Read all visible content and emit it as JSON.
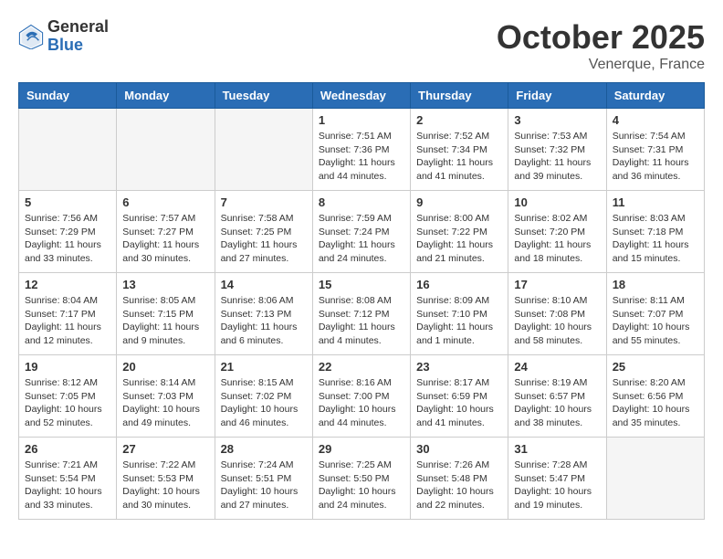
{
  "header": {
    "logo_general": "General",
    "logo_blue": "Blue",
    "month": "October 2025",
    "location": "Venerque, France"
  },
  "days_of_week": [
    "Sunday",
    "Monday",
    "Tuesday",
    "Wednesday",
    "Thursday",
    "Friday",
    "Saturday"
  ],
  "weeks": [
    [
      {
        "day": "",
        "info": ""
      },
      {
        "day": "",
        "info": ""
      },
      {
        "day": "",
        "info": ""
      },
      {
        "day": "1",
        "info": "Sunrise: 7:51 AM\nSunset: 7:36 PM\nDaylight: 11 hours and 44 minutes."
      },
      {
        "day": "2",
        "info": "Sunrise: 7:52 AM\nSunset: 7:34 PM\nDaylight: 11 hours and 41 minutes."
      },
      {
        "day": "3",
        "info": "Sunrise: 7:53 AM\nSunset: 7:32 PM\nDaylight: 11 hours and 39 minutes."
      },
      {
        "day": "4",
        "info": "Sunrise: 7:54 AM\nSunset: 7:31 PM\nDaylight: 11 hours and 36 minutes."
      }
    ],
    [
      {
        "day": "5",
        "info": "Sunrise: 7:56 AM\nSunset: 7:29 PM\nDaylight: 11 hours and 33 minutes."
      },
      {
        "day": "6",
        "info": "Sunrise: 7:57 AM\nSunset: 7:27 PM\nDaylight: 11 hours and 30 minutes."
      },
      {
        "day": "7",
        "info": "Sunrise: 7:58 AM\nSunset: 7:25 PM\nDaylight: 11 hours and 27 minutes."
      },
      {
        "day": "8",
        "info": "Sunrise: 7:59 AM\nSunset: 7:24 PM\nDaylight: 11 hours and 24 minutes."
      },
      {
        "day": "9",
        "info": "Sunrise: 8:00 AM\nSunset: 7:22 PM\nDaylight: 11 hours and 21 minutes."
      },
      {
        "day": "10",
        "info": "Sunrise: 8:02 AM\nSunset: 7:20 PM\nDaylight: 11 hours and 18 minutes."
      },
      {
        "day": "11",
        "info": "Sunrise: 8:03 AM\nSunset: 7:18 PM\nDaylight: 11 hours and 15 minutes."
      }
    ],
    [
      {
        "day": "12",
        "info": "Sunrise: 8:04 AM\nSunset: 7:17 PM\nDaylight: 11 hours and 12 minutes."
      },
      {
        "day": "13",
        "info": "Sunrise: 8:05 AM\nSunset: 7:15 PM\nDaylight: 11 hours and 9 minutes."
      },
      {
        "day": "14",
        "info": "Sunrise: 8:06 AM\nSunset: 7:13 PM\nDaylight: 11 hours and 6 minutes."
      },
      {
        "day": "15",
        "info": "Sunrise: 8:08 AM\nSunset: 7:12 PM\nDaylight: 11 hours and 4 minutes."
      },
      {
        "day": "16",
        "info": "Sunrise: 8:09 AM\nSunset: 7:10 PM\nDaylight: 11 hours and 1 minute."
      },
      {
        "day": "17",
        "info": "Sunrise: 8:10 AM\nSunset: 7:08 PM\nDaylight: 10 hours and 58 minutes."
      },
      {
        "day": "18",
        "info": "Sunrise: 8:11 AM\nSunset: 7:07 PM\nDaylight: 10 hours and 55 minutes."
      }
    ],
    [
      {
        "day": "19",
        "info": "Sunrise: 8:12 AM\nSunset: 7:05 PM\nDaylight: 10 hours and 52 minutes."
      },
      {
        "day": "20",
        "info": "Sunrise: 8:14 AM\nSunset: 7:03 PM\nDaylight: 10 hours and 49 minutes."
      },
      {
        "day": "21",
        "info": "Sunrise: 8:15 AM\nSunset: 7:02 PM\nDaylight: 10 hours and 46 minutes."
      },
      {
        "day": "22",
        "info": "Sunrise: 8:16 AM\nSunset: 7:00 PM\nDaylight: 10 hours and 44 minutes."
      },
      {
        "day": "23",
        "info": "Sunrise: 8:17 AM\nSunset: 6:59 PM\nDaylight: 10 hours and 41 minutes."
      },
      {
        "day": "24",
        "info": "Sunrise: 8:19 AM\nSunset: 6:57 PM\nDaylight: 10 hours and 38 minutes."
      },
      {
        "day": "25",
        "info": "Sunrise: 8:20 AM\nSunset: 6:56 PM\nDaylight: 10 hours and 35 minutes."
      }
    ],
    [
      {
        "day": "26",
        "info": "Sunrise: 7:21 AM\nSunset: 5:54 PM\nDaylight: 10 hours and 33 minutes."
      },
      {
        "day": "27",
        "info": "Sunrise: 7:22 AM\nSunset: 5:53 PM\nDaylight: 10 hours and 30 minutes."
      },
      {
        "day": "28",
        "info": "Sunrise: 7:24 AM\nSunset: 5:51 PM\nDaylight: 10 hours and 27 minutes."
      },
      {
        "day": "29",
        "info": "Sunrise: 7:25 AM\nSunset: 5:50 PM\nDaylight: 10 hours and 24 minutes."
      },
      {
        "day": "30",
        "info": "Sunrise: 7:26 AM\nSunset: 5:48 PM\nDaylight: 10 hours and 22 minutes."
      },
      {
        "day": "31",
        "info": "Sunrise: 7:28 AM\nSunset: 5:47 PM\nDaylight: 10 hours and 19 minutes."
      },
      {
        "day": "",
        "info": ""
      }
    ]
  ]
}
